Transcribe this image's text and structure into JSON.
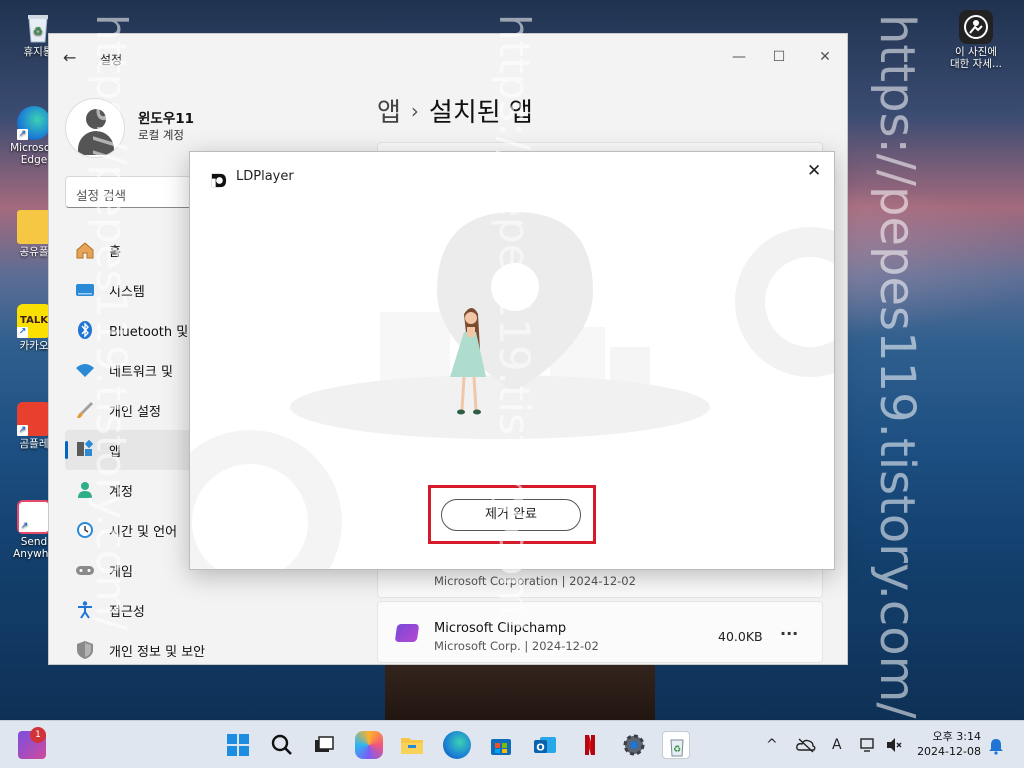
{
  "desktop": {
    "icons": [
      {
        "label": "휴지통"
      },
      {
        "label": "Microsoft Edge"
      },
      {
        "label": "공유폴"
      },
      {
        "label": "카카오"
      },
      {
        "label": "곰플레"
      },
      {
        "label": "Send Anywhe"
      }
    ],
    "right_icon": {
      "label_line1": "이 사진에",
      "label_line2": "대한 자세..."
    },
    "watermark": "https://pepes119.tistory.com/"
  },
  "settings": {
    "title": "설정",
    "profile": {
      "name": "윈도우11",
      "account_type": "로컬 계정"
    },
    "search": {
      "placeholder": "설정 검색"
    },
    "nav": [
      {
        "label": "홈",
        "icon": "home-icon"
      },
      {
        "label": "시스템",
        "icon": "system-icon"
      },
      {
        "label": "Bluetooth 및",
        "icon": "bluetooth-icon"
      },
      {
        "label": "네트워크 및",
        "icon": "wifi-icon"
      },
      {
        "label": "개인 설정",
        "icon": "brush-icon"
      },
      {
        "label": "앱",
        "icon": "apps-icon",
        "active": true
      },
      {
        "label": "계정",
        "icon": "account-icon"
      },
      {
        "label": "시간 및 언어",
        "icon": "clock-icon"
      },
      {
        "label": "게임",
        "icon": "gamepad-icon"
      },
      {
        "label": "접근성",
        "icon": "accessibility-icon"
      },
      {
        "label": "개인 정보 및 보안",
        "icon": "shield-icon"
      }
    ],
    "breadcrumb": {
      "parent": "앱",
      "separator": "›",
      "current": "설치된 앱"
    },
    "apps": [
      {
        "name": "",
        "meta": "Microsoft Corporation  |  2024-12-02",
        "size": ""
      },
      {
        "name": "Microsoft Clipchamp",
        "meta": "Microsoft Corp.  |  2024-12-02",
        "size": "40.0KB",
        "more": "···"
      }
    ]
  },
  "dialog": {
    "title": "LDPlayer",
    "close": "✕",
    "button_label": "제거 완료"
  },
  "taskbar": {
    "clock_period_time": "오후 3:14",
    "date": "2024-12-08",
    "widgets_badge": "1",
    "tray": {
      "chevron": "^",
      "ime": "A"
    }
  }
}
